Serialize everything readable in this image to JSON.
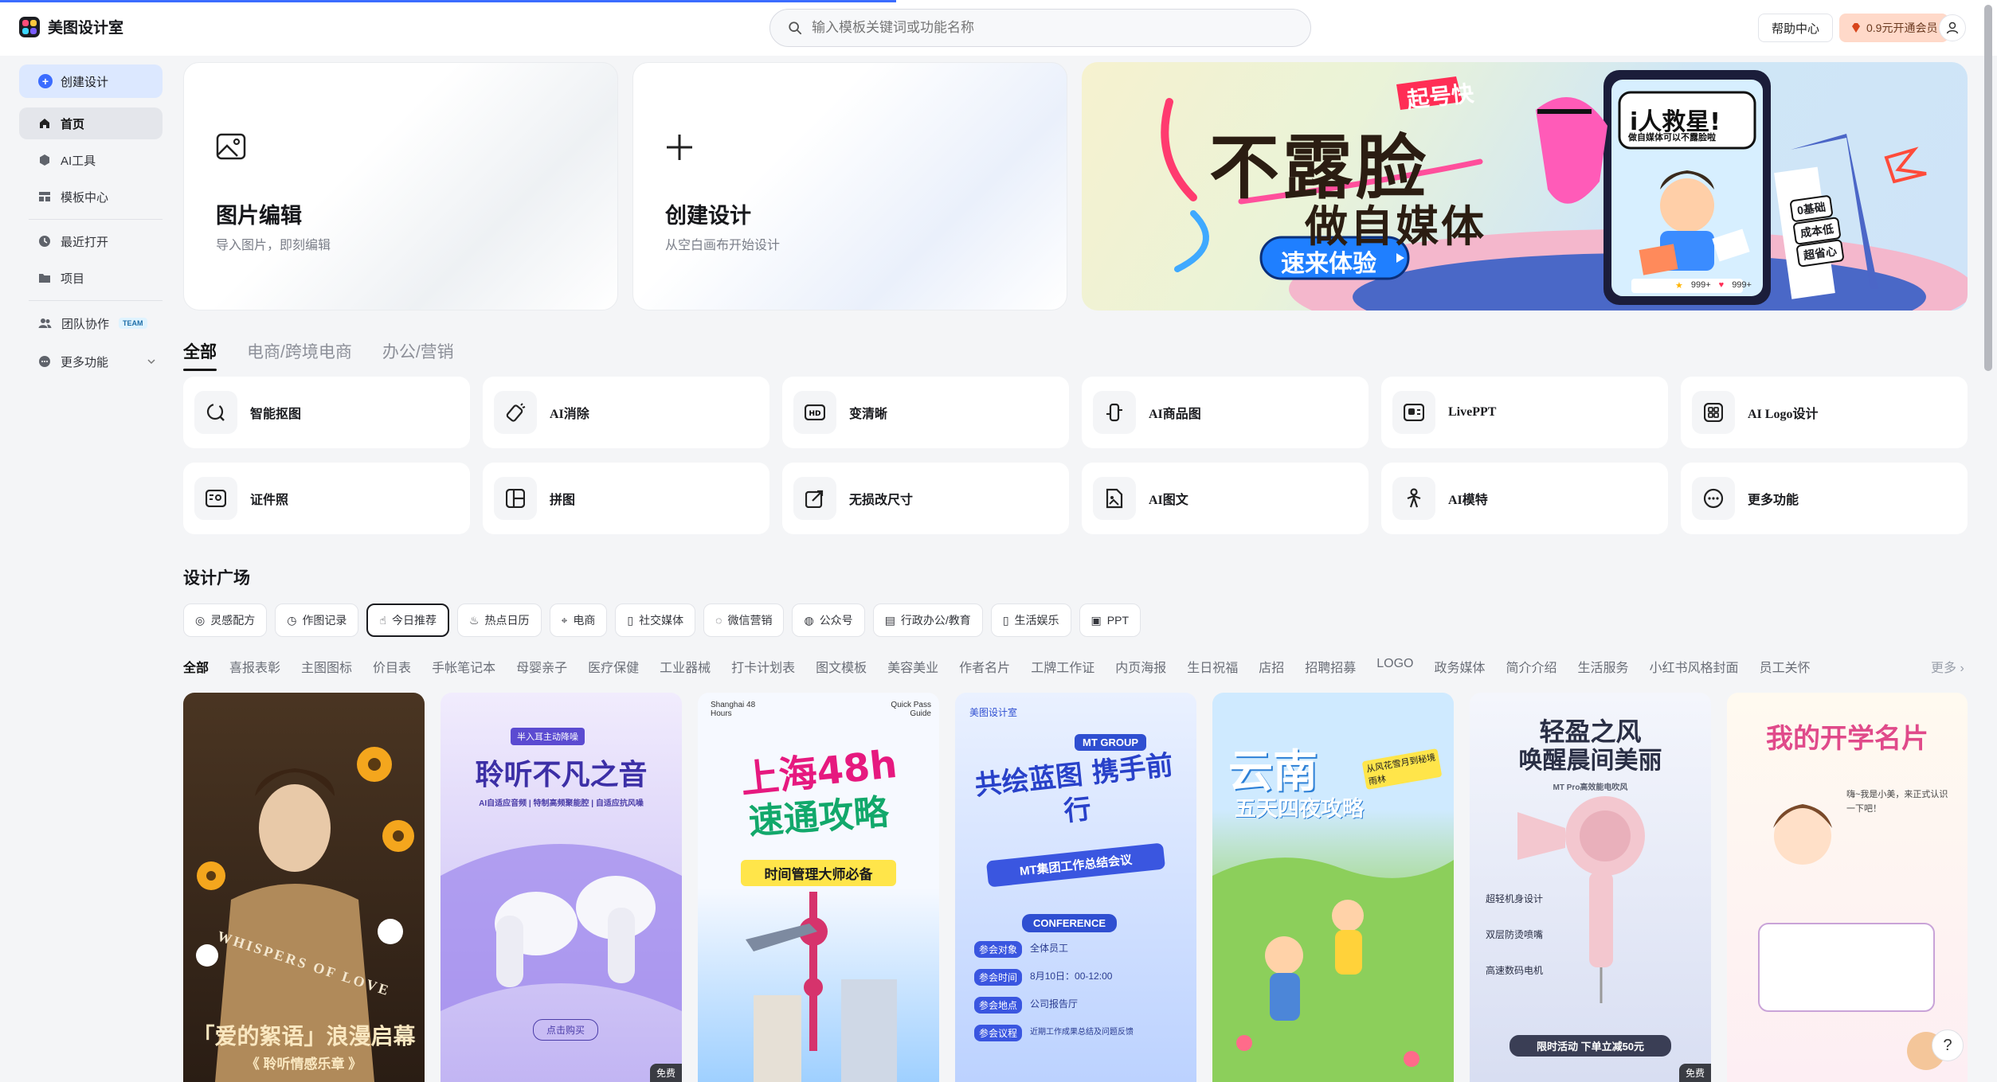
{
  "app": {
    "name": "美图设计室"
  },
  "search": {
    "placeholder": "输入模板关键词或功能名称"
  },
  "header": {
    "help": "帮助中心",
    "vip": "0.9元开通会员"
  },
  "sidebar": {
    "create": "创建设计",
    "items": [
      {
        "label": "首页",
        "icon": "home-icon"
      },
      {
        "label": "AI工具",
        "icon": "cube-icon"
      },
      {
        "label": "模板中心",
        "icon": "grid-icon"
      },
      {
        "label": "最近打开",
        "icon": "clock-icon"
      },
      {
        "label": "项目",
        "icon": "folder-icon"
      },
      {
        "label": "团队协作",
        "icon": "team-icon",
        "tag": "TEAM"
      },
      {
        "label": "更多功能",
        "icon": "more-icon"
      }
    ]
  },
  "hero": {
    "edit": {
      "title": "图片编辑",
      "sub": "导入图片，即刻编辑"
    },
    "create": {
      "title": "创建设计",
      "sub": "从空白画布开始设计"
    },
    "banner": {
      "badge": "起号快",
      "headline": "不露脸",
      "sub": "做自媒体",
      "cta": "速来体验",
      "bubble": "i人救星!",
      "bubble_sub": "做自媒体可以不露脸啦",
      "tags": [
        "0基础",
        "成本低",
        "超省心"
      ],
      "likes": "999+",
      "hearts": "999+"
    }
  },
  "tabs": [
    "全部",
    "电商/跨境电商",
    "办公/营销"
  ],
  "tools": [
    {
      "label": "智能抠图",
      "icon": "cutout-icon"
    },
    {
      "label": "AI消除",
      "icon": "eraser-icon"
    },
    {
      "label": "变清晰",
      "icon": "hd-icon"
    },
    {
      "label": "AI商品图",
      "icon": "product-icon"
    },
    {
      "label": "LivePPT",
      "icon": "ppt-icon"
    },
    {
      "label": "AI Logo设计",
      "icon": "logo-design-icon"
    },
    {
      "label": "证件照",
      "icon": "id-photo-icon"
    },
    {
      "label": "拼图",
      "icon": "collage-icon"
    },
    {
      "label": "无损改尺寸",
      "icon": "resize-icon"
    },
    {
      "label": "AI图文",
      "icon": "ai-text-image-icon"
    },
    {
      "label": "AI模特",
      "icon": "model-icon"
    },
    {
      "label": "更多功能",
      "icon": "more-icon"
    }
  ],
  "plaza": {
    "title": "设计广场",
    "chips": [
      {
        "label": "灵感配方",
        "icon": "palette-icon"
      },
      {
        "label": "作图记录",
        "icon": "clock-icon"
      },
      {
        "label": "今日推荐",
        "icon": "thumb-icon"
      },
      {
        "label": "热点日历",
        "icon": "fire-icon"
      },
      {
        "label": "电商",
        "icon": "cart-icon"
      },
      {
        "label": "社交媒体",
        "icon": "phone-icon"
      },
      {
        "label": "微信营销",
        "icon": "wechat-icon"
      },
      {
        "label": "公众号",
        "icon": "account-icon"
      },
      {
        "label": "行政办公/教育",
        "icon": "doc-icon"
      },
      {
        "label": "生活娱乐",
        "icon": "phone-icon"
      },
      {
        "label": "PPT",
        "icon": "ppt-icon"
      }
    ],
    "categories": [
      "全部",
      "喜报表彰",
      "主图图标",
      "价目表",
      "手帐笔记本",
      "母婴亲子",
      "医疗保健",
      "工业器械",
      "打卡计划表",
      "图文模板",
      "美容美业",
      "作者名片",
      "工牌工作证",
      "内页海报",
      "生日祝福",
      "店招",
      "招聘招募",
      "LOGO",
      "政务媒体",
      "简介介绍",
      "生活服务",
      "小红书风格封面",
      "员工关怀"
    ],
    "more": "更多 ›"
  },
  "templates": [
    {
      "title": "「爱的絮语」浪漫启幕",
      "sub": "《 聆听情感乐章 》",
      "top": "WHISPERS OF LOVE",
      "colors": [
        "#3b2a1e",
        "#6b4a2a"
      ]
    },
    {
      "title": "聆听不凡之音",
      "sub": "AI自适应音频 | 特制高频聚能腔 | 自适应抗风噪",
      "badge": "半入耳主动降噪",
      "btn": "点击购买",
      "free": "免费",
      "colors": [
        "#ece6fb",
        "#b8a9f0"
      ]
    },
    {
      "title": "上海48h",
      "sub": "速通攻略",
      "tag": "时间管理大师必备",
      "corner_left": "Shanghai 48 Hours",
      "corner_right": "Quick Pass Guide",
      "colors": [
        "#f2f7ff",
        "#9fd0ff"
      ]
    },
    {
      "title": "共绘蓝图 携手前行",
      "sub": "MT集团工作总结会议",
      "brand": "美图设计室",
      "group": "MT GROUP",
      "conf": "CONFERENCE",
      "rows": [
        [
          "参会对象",
          "全体员工"
        ],
        [
          "参会时间",
          "8月10日：00-12:00"
        ],
        [
          "参会地点",
          "公司报告厅"
        ],
        [
          "参会议程",
          "近期工作成果总结及问题反馈"
        ]
      ],
      "colors": [
        "#e9f1ff",
        "#7aa7ff"
      ]
    },
    {
      "title": "云南",
      "sub": "五天四夜攻略",
      "tag": "从风花雪月到秘境雨林",
      "colors": [
        "#d9f0ff",
        "#9ad56a"
      ]
    },
    {
      "title": "轻盈之风",
      "sub": "唤醒晨间美丽",
      "model": "MT Pro高效能电吹风",
      "features": [
        "超轻机身设计",
        "双层防烫喷嘴",
        "高速数码电机"
      ],
      "promo": "限时活动 下单立减50元",
      "free": "免费",
      "colors": [
        "#eef2fb",
        "#d7def5"
      ]
    },
    {
      "title": "我的开学名片",
      "sub": "嗨~我是小美，来正式认识一下吧！",
      "colors": [
        "#fff9ee",
        "#fde8ef"
      ]
    }
  ]
}
